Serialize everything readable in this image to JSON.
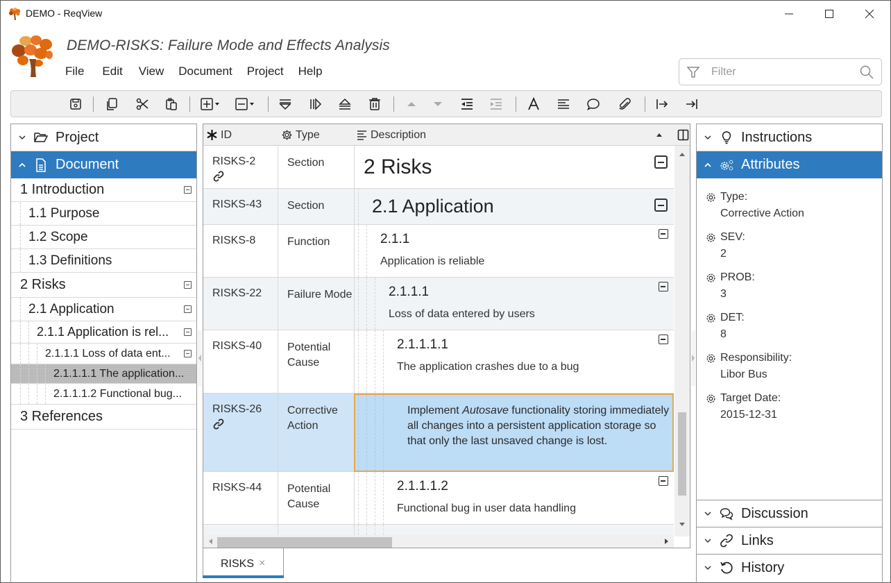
{
  "window": {
    "title": "DEMO - ReqView",
    "minimize_label": "minimize",
    "maximize_label": "maximize",
    "close_label": "close"
  },
  "header": {
    "document_title": "DEMO-RISKS: Failure Mode and Effects Analysis",
    "menu": [
      "File",
      "Edit",
      "View",
      "Document",
      "Project",
      "Help"
    ],
    "filter": {
      "placeholder": "Filter",
      "value": ""
    }
  },
  "toolbar": {
    "buttons": [
      {
        "icon": "save-icon",
        "enabled": true
      },
      {
        "icon": "copy-icon",
        "enabled": true
      },
      {
        "icon": "cut-icon",
        "enabled": true
      },
      {
        "icon": "paste-icon",
        "enabled": true
      },
      {
        "icon": "add-object-dropdown-icon",
        "enabled": true
      },
      {
        "icon": "remove-object-dropdown-icon",
        "enabled": true
      },
      {
        "icon": "insert-below-icon",
        "enabled": true
      },
      {
        "icon": "insert-child-icon",
        "enabled": true
      },
      {
        "icon": "insert-above-icon",
        "enabled": true
      },
      {
        "icon": "delete-icon",
        "enabled": true
      },
      {
        "icon": "move-up-icon",
        "enabled": false
      },
      {
        "icon": "move-down-icon",
        "enabled": false
      },
      {
        "icon": "outdent-icon",
        "enabled": true
      },
      {
        "icon": "indent-icon",
        "enabled": false
      },
      {
        "icon": "text-format-icon",
        "enabled": true
      },
      {
        "icon": "align-icon",
        "enabled": true
      },
      {
        "icon": "comment-icon",
        "enabled": true
      },
      {
        "icon": "attachment-icon",
        "enabled": true
      },
      {
        "icon": "link-from-icon",
        "enabled": true
      },
      {
        "icon": "link-to-icon",
        "enabled": true
      }
    ]
  },
  "left_panel": {
    "project_label": "Project",
    "document_label": "Document",
    "tree": [
      {
        "label": "1 Introduction",
        "level": 0,
        "collapsible": true
      },
      {
        "label": "1.1 Purpose",
        "level": 1,
        "collapsible": false
      },
      {
        "label": "1.2 Scope",
        "level": 1,
        "collapsible": false
      },
      {
        "label": "1.3 Definitions",
        "level": 1,
        "collapsible": false
      },
      {
        "label": "2 Risks",
        "level": 0,
        "collapsible": true
      },
      {
        "label": "2.1 Application",
        "level": 1,
        "collapsible": true
      },
      {
        "label": "2.1.1 Application is rel...",
        "level": 2,
        "collapsible": true
      },
      {
        "label": "2.1.1.1 Loss of data ent...",
        "level": 3,
        "collapsible": true
      },
      {
        "label": "2.1.1.1.1 The application...",
        "level": 4,
        "collapsible": false,
        "selected": true
      },
      {
        "label": "2.1.1.1.2 Functional bug...",
        "level": 4,
        "collapsible": false
      },
      {
        "label": "3 References",
        "level": 0,
        "collapsible": false
      }
    ]
  },
  "grid": {
    "columns": {
      "id": "ID",
      "type": "Type",
      "description": "Description"
    },
    "rows": [
      {
        "id": "RISKS-2",
        "type": "Section",
        "heading": "2 Risks",
        "text": "",
        "has_link": true
      },
      {
        "id": "RISKS-43",
        "type": "Section",
        "heading": "2.1 Application",
        "text": "",
        "has_link": false
      },
      {
        "id": "RISKS-8",
        "type": "Function",
        "heading": "2.1.1",
        "text": "Application is reliable",
        "has_link": false
      },
      {
        "id": "RISKS-22",
        "type": "Failure Mode",
        "heading": "2.1.1.1",
        "text": "Loss of data entered by users",
        "has_link": false
      },
      {
        "id": "RISKS-40",
        "type": "Potential Cause",
        "heading": "2.1.1.1.1",
        "text": "The application crashes due to a bug",
        "has_link": false
      },
      {
        "id": "RISKS-26",
        "type": "Corrective Action",
        "heading": "",
        "text_before": "Implement ",
        "text_italic": "Autosave",
        "text_after": " functionality storing immediately all changes into a persistent application storage so that only the last unsaved change is lost.",
        "has_link": true,
        "selected": true
      },
      {
        "id": "RISKS-44",
        "type": "Potential Cause",
        "heading": "2.1.1.1.2",
        "text": "Functional bug in user data handling",
        "has_link": false
      }
    ]
  },
  "tabs": [
    {
      "label": "RISKS",
      "close": "×",
      "active": true
    }
  ],
  "right_panel": {
    "instructions_label": "Instructions",
    "attributes_label": "Attributes",
    "attributes": [
      {
        "name": "Type:",
        "value": "Corrective Action"
      },
      {
        "name": "SEV:",
        "value": "2"
      },
      {
        "name": "PROB:",
        "value": "3"
      },
      {
        "name": "DET:",
        "value": "8"
      },
      {
        "name": "Responsibility:",
        "value": "Libor Bus"
      },
      {
        "name": "Target Date:",
        "value": "2015-12-31"
      }
    ],
    "discussion_label": "Discussion",
    "links_label": "Links",
    "history_label": "History"
  },
  "colors": {
    "accent": "#2e7bbf",
    "selected_row": "#cfe4f7",
    "editor_bg": "#bddcf6",
    "editor_border": "#e8a84a",
    "alt_row": "#f1f4f7"
  }
}
